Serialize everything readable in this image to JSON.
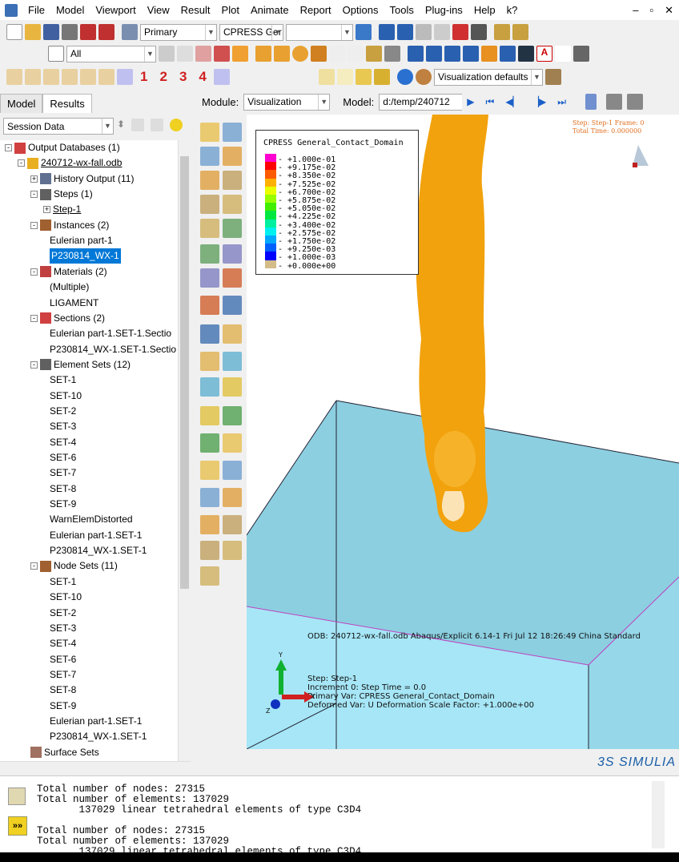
{
  "menu": [
    "File",
    "Model",
    "Viewport",
    "View",
    "Result",
    "Plot",
    "Animate",
    "Report",
    "Options",
    "Tools",
    "Plug-ins",
    "Help"
  ],
  "toolbar": {
    "primary": "Primary",
    "variable": "CPRESS",
    "variable_sub": "Ger",
    "selection_filter": "All",
    "view_defaults": "Visualization defaults",
    "steps": [
      "1",
      "2",
      "3",
      "4"
    ]
  },
  "context": {
    "module_label": "Module:",
    "module": "Visualization",
    "model_label": "Model:",
    "model": "d:/temp/240712"
  },
  "left_tabs": [
    "Model",
    "Results"
  ],
  "session_combo": "Session Data",
  "tree": [
    {
      "label": "Output Databases (1)",
      "level": 0,
      "exp": "-"
    },
    {
      "label": "240712-wx-fall.odb",
      "level": 1,
      "exp": "-",
      "u": true
    },
    {
      "label": "History Output (11)",
      "level": 2,
      "exp": "+"
    },
    {
      "label": "Steps (1)",
      "level": 2,
      "exp": "-"
    },
    {
      "label": "Step-1",
      "level": 3,
      "exp": "+",
      "u": true
    },
    {
      "label": "Instances (2)",
      "level": 2,
      "exp": "-"
    },
    {
      "label": "Eulerian part-1",
      "level": 3
    },
    {
      "label": "P230814_WX-1",
      "level": 3,
      "sel": true
    },
    {
      "label": "Materials (2)",
      "level": 2,
      "exp": "-"
    },
    {
      "label": "(Multiple)",
      "level": 3
    },
    {
      "label": "LIGAMENT",
      "level": 3
    },
    {
      "label": "Sections (2)",
      "level": 2,
      "exp": "-"
    },
    {
      "label": "Eulerian part-1.SET-1.Sectio",
      "level": 3
    },
    {
      "label": "P230814_WX-1.SET-1.Sectio",
      "level": 3
    },
    {
      "label": "Element Sets (12)",
      "level": 2,
      "exp": "-"
    },
    {
      "label": "SET-1",
      "level": 3
    },
    {
      "label": "SET-10",
      "level": 3
    },
    {
      "label": "SET-2",
      "level": 3
    },
    {
      "label": "SET-3",
      "level": 3
    },
    {
      "label": "SET-4",
      "level": 3
    },
    {
      "label": "SET-6",
      "level": 3
    },
    {
      "label": "SET-7",
      "level": 3
    },
    {
      "label": "SET-8",
      "level": 3
    },
    {
      "label": "SET-9",
      "level": 3
    },
    {
      "label": "WarnElemDistorted",
      "level": 3
    },
    {
      "label": "Eulerian part-1.SET-1",
      "level": 3
    },
    {
      "label": "P230814_WX-1.SET-1",
      "level": 3
    },
    {
      "label": "Node Sets (11)",
      "level": 2,
      "exp": "-"
    },
    {
      "label": "SET-1",
      "level": 3
    },
    {
      "label": "SET-10",
      "level": 3
    },
    {
      "label": "SET-2",
      "level": 3
    },
    {
      "label": "SET-3",
      "level": 3
    },
    {
      "label": "SET-4",
      "level": 3
    },
    {
      "label": "SET-6",
      "level": 3
    },
    {
      "label": "SET-7",
      "level": 3
    },
    {
      "label": "SET-8",
      "level": 3
    },
    {
      "label": "SET-9",
      "level": 3
    },
    {
      "label": "Eulerian part-1.SET-1",
      "level": 3
    },
    {
      "label": "P230814_WX-1.SET-1",
      "level": 3
    },
    {
      "label": "Surface Sets",
      "level": 2
    }
  ],
  "legend": {
    "title": "CPRESS   General_Contact_Domain",
    "values": [
      "+1.000e-01",
      "+9.175e-02",
      "+8.350e-02",
      "+7.525e-02",
      "+6.700e-02",
      "+5.875e-02",
      "+5.050e-02",
      "+4.225e-02",
      "+3.400e-02",
      "+2.575e-02",
      "+1.750e-02",
      "+9.250e-03",
      "+1.000e-03",
      "+0.000e+00"
    ],
    "colors": [
      "#ff00d0",
      "#ff0000",
      "#ff5a00",
      "#ffb000",
      "#e8ff00",
      "#98ff00",
      "#40ee00",
      "#00e840",
      "#00f0a0",
      "#00f0f0",
      "#00a8ff",
      "#0060ff",
      "#0000ff",
      "#d4bc88"
    ]
  },
  "status": {
    "step": "Step: Step-1    Frame: 0",
    "time": "Total Time: 0.000000"
  },
  "info": {
    "odb": "ODB: 240712-wx-fall.odb    Abaqus/Explicit 6.14-1    Fri Jul 12 18:26:49 China Standard",
    "step": "Step: Step-1",
    "increment": "Increment      0: Step Time = 0.0",
    "primary": "Primary Var: CPRESS   General_Contact_Domain",
    "deformed": "Deformed Var: U   Deformation Scale Factor: +1.000e+00"
  },
  "triad": {
    "x": "X",
    "y": "Y",
    "z": "Z"
  },
  "brand": "3S SIMULIA",
  "messages": "Total number of nodes: 27315\nTotal number of elements: 137029\n       137029 linear tetrahedral elements of type C3D4\n\nTotal number of nodes: 27315\nTotal number of elements: 137029\n       137029 linear tetrahedral elements of type C3D4"
}
